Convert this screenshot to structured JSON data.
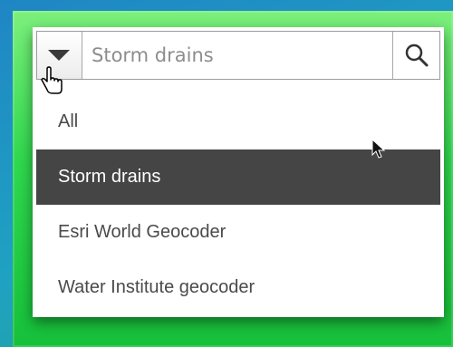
{
  "search": {
    "placeholder": "Storm drains",
    "value": ""
  },
  "menu": {
    "items": [
      {
        "label": "All",
        "selected": false
      },
      {
        "label": "Storm drains",
        "selected": true
      },
      {
        "label": "Esri World Geocoder",
        "selected": false
      },
      {
        "label": "Water Institute geocoder",
        "selected": false
      }
    ]
  },
  "icons": {
    "toggle": "chevron-down-icon",
    "search": "search-icon",
    "pointer_cursor": "hand-pointer-icon",
    "arrow_cursor": "arrow-cursor-icon"
  },
  "colors": {
    "selected_bg": "#454545",
    "selected_text": "#ffffff",
    "item_text": "#4a4a4a",
    "placeholder_text": "#8d8d8d"
  }
}
